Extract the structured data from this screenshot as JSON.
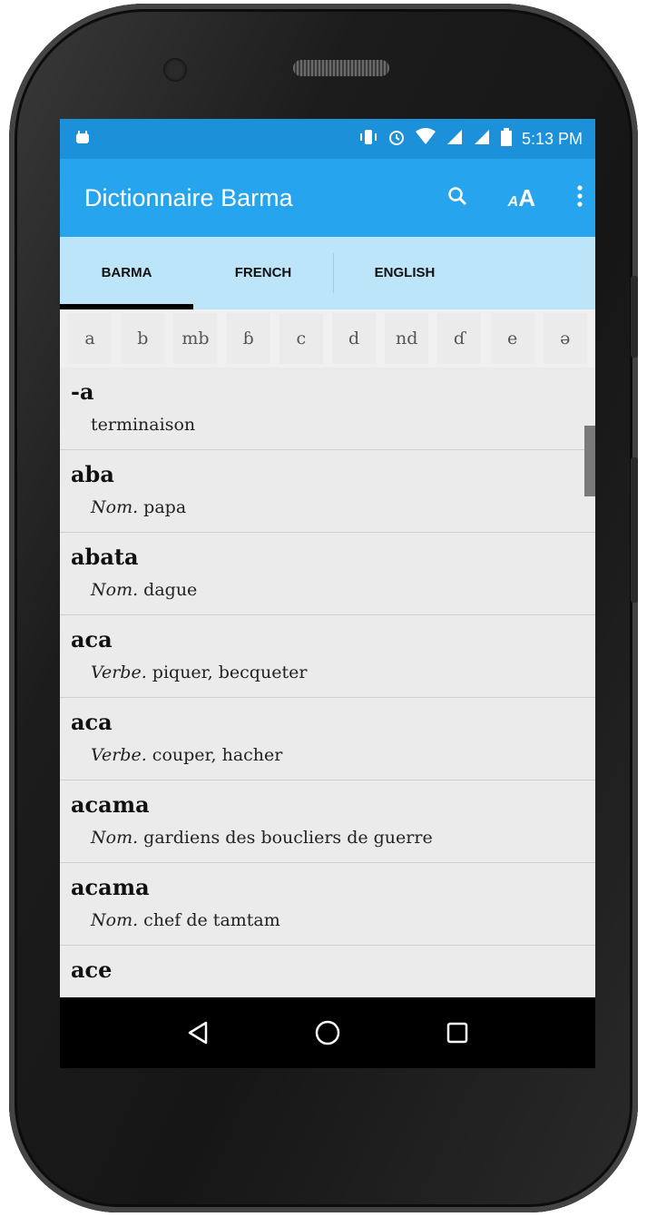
{
  "status_bar": {
    "time": "5:13 PM",
    "icons": [
      "android-notification-icon",
      "vibrate-icon",
      "alarm-icon",
      "wifi-icon",
      "signal-icon",
      "signal-icon",
      "battery-icon"
    ]
  },
  "app_bar": {
    "title": "Dictionnaire Barma",
    "actions": [
      "search-icon",
      "font-size-icon",
      "overflow-menu-icon"
    ],
    "font_icon_text": "AA"
  },
  "tabs": [
    {
      "label": "BARMA",
      "selected": true
    },
    {
      "label": "FRENCH",
      "selected": false
    },
    {
      "label": "ENGLISH",
      "selected": false
    }
  ],
  "letters": [
    "a",
    "b",
    "mb",
    "ɓ",
    "c",
    "d",
    "nd",
    "ɗ",
    "e",
    "ə"
  ],
  "entries": [
    {
      "word": "-a",
      "pos": "",
      "gloss": "terminaison"
    },
    {
      "word": "aba",
      "pos": "Nom.",
      "gloss": "papa"
    },
    {
      "word": "abata",
      "pos": "Nom.",
      "gloss": "dague"
    },
    {
      "word": "aca",
      "pos": "Verbe.",
      "gloss": "piquer, becqueter"
    },
    {
      "word": "aca",
      "pos": "Verbe.",
      "gloss": "couper, hacher"
    },
    {
      "word": "acama",
      "pos": "Nom.",
      "gloss": "gardiens des boucliers de guerre"
    },
    {
      "word": "acama",
      "pos": "Nom.",
      "gloss": "chef de tamtam"
    },
    {
      "word": "ace",
      "pos": "",
      "gloss": ""
    }
  ],
  "colors": {
    "status_bar": "#1c90d9",
    "app_bar": "#27a4ee",
    "tabs": "#bde5fa",
    "list_bg": "#ebebeb"
  },
  "nav_bar": [
    "back-icon",
    "home-icon",
    "recents-icon"
  ]
}
